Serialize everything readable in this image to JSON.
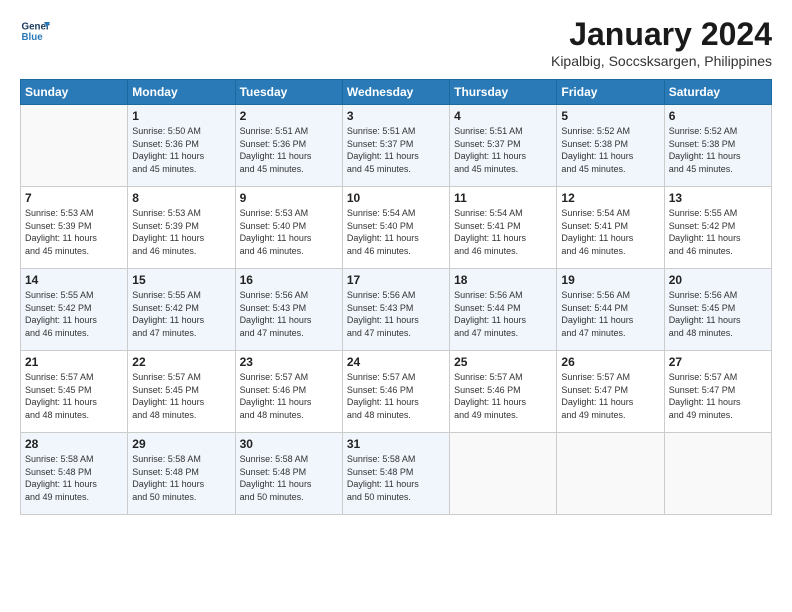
{
  "header": {
    "logo_line1": "General",
    "logo_line2": "Blue",
    "month": "January 2024",
    "location": "Kipalbig, Soccsksargen, Philippines"
  },
  "days_of_week": [
    "Sunday",
    "Monday",
    "Tuesday",
    "Wednesday",
    "Thursday",
    "Friday",
    "Saturday"
  ],
  "weeks": [
    [
      {
        "day": "",
        "info": ""
      },
      {
        "day": "1",
        "info": "Sunrise: 5:50 AM\nSunset: 5:36 PM\nDaylight: 11 hours\nand 45 minutes."
      },
      {
        "day": "2",
        "info": "Sunrise: 5:51 AM\nSunset: 5:36 PM\nDaylight: 11 hours\nand 45 minutes."
      },
      {
        "day": "3",
        "info": "Sunrise: 5:51 AM\nSunset: 5:37 PM\nDaylight: 11 hours\nand 45 minutes."
      },
      {
        "day": "4",
        "info": "Sunrise: 5:51 AM\nSunset: 5:37 PM\nDaylight: 11 hours\nand 45 minutes."
      },
      {
        "day": "5",
        "info": "Sunrise: 5:52 AM\nSunset: 5:38 PM\nDaylight: 11 hours\nand 45 minutes."
      },
      {
        "day": "6",
        "info": "Sunrise: 5:52 AM\nSunset: 5:38 PM\nDaylight: 11 hours\nand 45 minutes."
      }
    ],
    [
      {
        "day": "7",
        "info": "Sunrise: 5:53 AM\nSunset: 5:39 PM\nDaylight: 11 hours\nand 45 minutes."
      },
      {
        "day": "8",
        "info": "Sunrise: 5:53 AM\nSunset: 5:39 PM\nDaylight: 11 hours\nand 46 minutes."
      },
      {
        "day": "9",
        "info": "Sunrise: 5:53 AM\nSunset: 5:40 PM\nDaylight: 11 hours\nand 46 minutes."
      },
      {
        "day": "10",
        "info": "Sunrise: 5:54 AM\nSunset: 5:40 PM\nDaylight: 11 hours\nand 46 minutes."
      },
      {
        "day": "11",
        "info": "Sunrise: 5:54 AM\nSunset: 5:41 PM\nDaylight: 11 hours\nand 46 minutes."
      },
      {
        "day": "12",
        "info": "Sunrise: 5:54 AM\nSunset: 5:41 PM\nDaylight: 11 hours\nand 46 minutes."
      },
      {
        "day": "13",
        "info": "Sunrise: 5:55 AM\nSunset: 5:42 PM\nDaylight: 11 hours\nand 46 minutes."
      }
    ],
    [
      {
        "day": "14",
        "info": "Sunrise: 5:55 AM\nSunset: 5:42 PM\nDaylight: 11 hours\nand 46 minutes."
      },
      {
        "day": "15",
        "info": "Sunrise: 5:55 AM\nSunset: 5:42 PM\nDaylight: 11 hours\nand 47 minutes."
      },
      {
        "day": "16",
        "info": "Sunrise: 5:56 AM\nSunset: 5:43 PM\nDaylight: 11 hours\nand 47 minutes."
      },
      {
        "day": "17",
        "info": "Sunrise: 5:56 AM\nSunset: 5:43 PM\nDaylight: 11 hours\nand 47 minutes."
      },
      {
        "day": "18",
        "info": "Sunrise: 5:56 AM\nSunset: 5:44 PM\nDaylight: 11 hours\nand 47 minutes."
      },
      {
        "day": "19",
        "info": "Sunrise: 5:56 AM\nSunset: 5:44 PM\nDaylight: 11 hours\nand 47 minutes."
      },
      {
        "day": "20",
        "info": "Sunrise: 5:56 AM\nSunset: 5:45 PM\nDaylight: 11 hours\nand 48 minutes."
      }
    ],
    [
      {
        "day": "21",
        "info": "Sunrise: 5:57 AM\nSunset: 5:45 PM\nDaylight: 11 hours\nand 48 minutes."
      },
      {
        "day": "22",
        "info": "Sunrise: 5:57 AM\nSunset: 5:45 PM\nDaylight: 11 hours\nand 48 minutes."
      },
      {
        "day": "23",
        "info": "Sunrise: 5:57 AM\nSunset: 5:46 PM\nDaylight: 11 hours\nand 48 minutes."
      },
      {
        "day": "24",
        "info": "Sunrise: 5:57 AM\nSunset: 5:46 PM\nDaylight: 11 hours\nand 48 minutes."
      },
      {
        "day": "25",
        "info": "Sunrise: 5:57 AM\nSunset: 5:46 PM\nDaylight: 11 hours\nand 49 minutes."
      },
      {
        "day": "26",
        "info": "Sunrise: 5:57 AM\nSunset: 5:47 PM\nDaylight: 11 hours\nand 49 minutes."
      },
      {
        "day": "27",
        "info": "Sunrise: 5:57 AM\nSunset: 5:47 PM\nDaylight: 11 hours\nand 49 minutes."
      }
    ],
    [
      {
        "day": "28",
        "info": "Sunrise: 5:58 AM\nSunset: 5:48 PM\nDaylight: 11 hours\nand 49 minutes."
      },
      {
        "day": "29",
        "info": "Sunrise: 5:58 AM\nSunset: 5:48 PM\nDaylight: 11 hours\nand 50 minutes."
      },
      {
        "day": "30",
        "info": "Sunrise: 5:58 AM\nSunset: 5:48 PM\nDaylight: 11 hours\nand 50 minutes."
      },
      {
        "day": "31",
        "info": "Sunrise: 5:58 AM\nSunset: 5:48 PM\nDaylight: 11 hours\nand 50 minutes."
      },
      {
        "day": "",
        "info": ""
      },
      {
        "day": "",
        "info": ""
      },
      {
        "day": "",
        "info": ""
      }
    ]
  ]
}
